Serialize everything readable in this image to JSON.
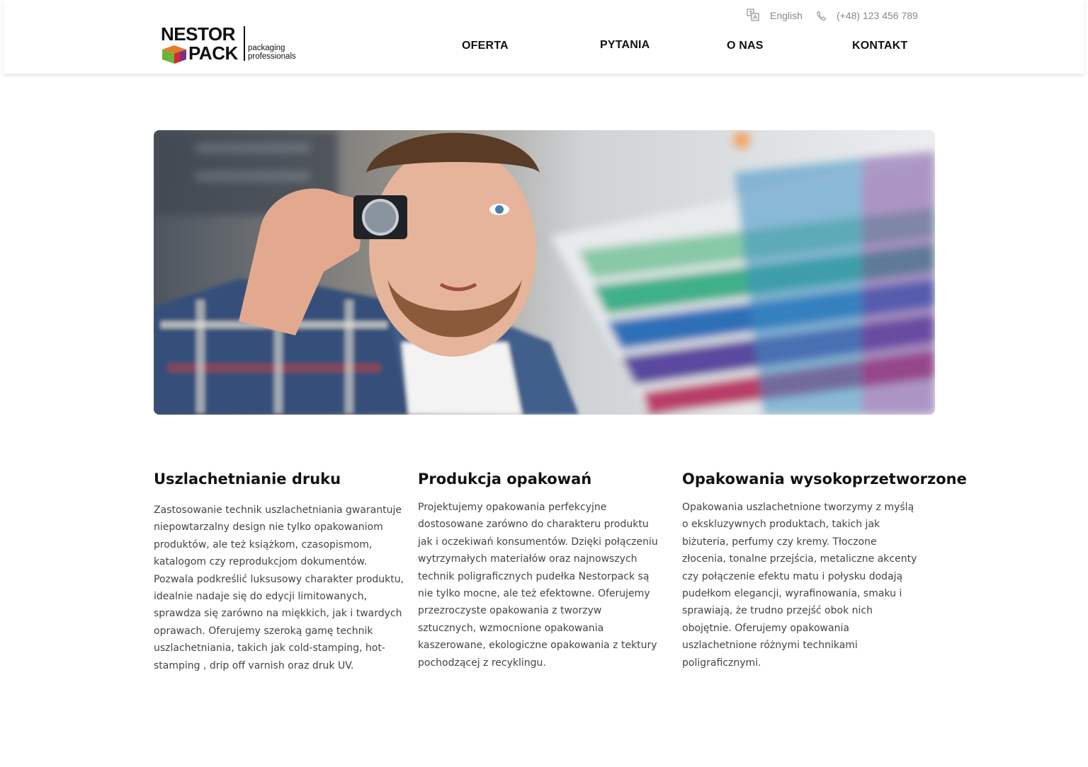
{
  "brand": {
    "logo_line1": "NESTOR",
    "logo_line2": "PACK",
    "tagline_line1": "packaging",
    "tagline_line2": "professionals"
  },
  "utility": {
    "language_label": "English",
    "phone": "(+48) 123 456 789"
  },
  "nav": {
    "items": [
      {
        "label": "OFERTA"
      },
      {
        "label": "PYTANIA"
      },
      {
        "label": "O NAS"
      },
      {
        "label": "KONTAKT"
      }
    ]
  },
  "colors": {
    "accent_text": "#111111",
    "muted_text": "#888888",
    "body_text": "#444444",
    "cube_top": "#e07b2a",
    "cube_left": "#6bb33a",
    "cube_right": "#7a2f8c",
    "cube_front": "#d9262e"
  },
  "sections": [
    {
      "title": "Uszlachetnianie druku",
      "text": "Zastosowanie technik uszlachetniania gwarantuje niepowtarzalny design nie tylko opakowaniom produktów, ale też książkom, czasopismom, katalogom czy reprodukcjom dokumentów. Pozwala podkreślić luksusowy charakter produktu, idealnie nadaje się do edycji limitowanych, sprawdza się zarówno na miękkich, jak i twardych oprawach. Oferujemy szeroką gamę technik uszlachetniania, takich jak cold-stamping, hot-stamping , drip off varnish oraz druk UV."
    },
    {
      "title": "Produkcja opakowań",
      "text": "Projektujemy opakowania perfekcyjne dostosowane zarówno do charakteru produktu jak i oczekiwań konsumentów. Dzięki połączeniu wytrzymałych materiałów oraz najnowszych technik poligraficznych pudełka Nestorpack są nie tylko mocne, ale też efektowne. Oferujemy przezroczyste opakowania z tworzyw sztucznych, wzmocnione opakowania kaszerowane, ekologiczne opakowania z tektury pochodzącej z recyklingu."
    },
    {
      "title": "Opakowania wysokoprzetworzone",
      "text": "Opakowania uszlachetnione tworzymy z myślą o ekskluzywnych produktach, takich jak biżuteria, perfumy czy kremy. Tłoczone złocenia, tonalne przejścia, metaliczne akcenty czy połączenie efektu matu i połysku dodają pudełkom elegancji, wyrafinowania, smaku i sprawiają, że trudno przejść obok nich obojętnie. Oferujemy opakowania uszlachetnione różnymi technikami poligraficznymi."
    }
  ]
}
